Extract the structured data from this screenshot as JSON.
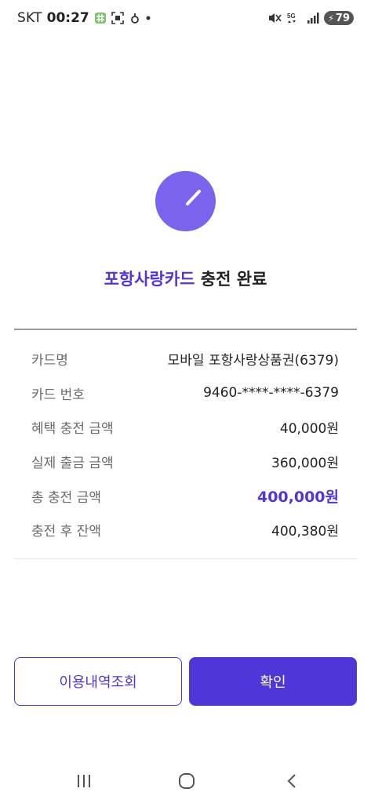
{
  "status_bar": {
    "carrier": "SKT",
    "time": "00:27",
    "network": "5G",
    "battery": "79"
  },
  "result": {
    "title_accent": "포항사랑카드",
    "title_rest": " 충전 완료",
    "status_icon": "check-icon",
    "accent_color": "#4f36d8",
    "circle_color": "#7b63ee"
  },
  "details": [
    {
      "label": "카드명",
      "value": "모바일 포항사랑상품권(6379)"
    },
    {
      "label": "카드 번호",
      "value": "9460-****-****-6379"
    },
    {
      "label": "혜택 충전 금액",
      "value": "40,000원"
    },
    {
      "label": "실제 출금 금액",
      "value": "360,000원"
    },
    {
      "label": "총 충전 금액",
      "value": "400,000원"
    },
    {
      "label": "충전 후 잔액",
      "value": "400,380원"
    }
  ],
  "buttons": {
    "history": "이용내역조회",
    "confirm": "확인"
  }
}
